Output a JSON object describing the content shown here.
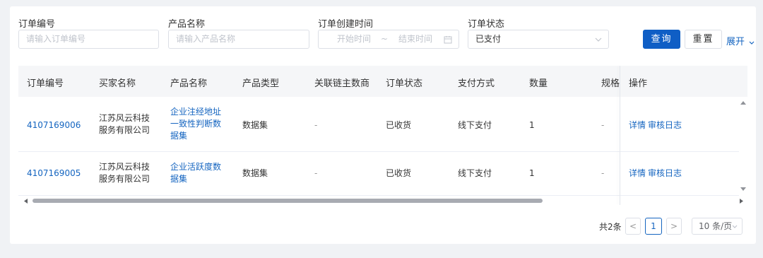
{
  "filters": {
    "order_no": {
      "label": "订单编号",
      "placeholder": "请输入订单编号"
    },
    "product_name": {
      "label": "产品名称",
      "placeholder": "请输入产品名称"
    },
    "create_time": {
      "label": "订单创建时间",
      "start_placeholder": "开始时间",
      "separator": "~",
      "end_placeholder": "结束时间"
    },
    "status": {
      "label": "订单状态",
      "value": "已支付"
    },
    "query_label": "查询",
    "reset_label": "重置",
    "expand_label": "展开"
  },
  "table": {
    "columns": [
      "订单编号",
      "买家名称",
      "产品名称",
      "产品类型",
      "关联链主数商",
      "订单状态",
      "支付方式",
      "数量",
      "规格",
      "操作"
    ],
    "rows": [
      {
        "order_no": "4107169006",
        "buyer": [
          "江苏风云科技",
          "服务有限公司"
        ],
        "product": [
          "企业注经地址",
          "一致性判断数",
          "据集"
        ],
        "type": "数据集",
        "chain": "-",
        "status": "已收货",
        "payment": "线下支付",
        "qty": "1",
        "spec": "-",
        "actions": [
          "详情",
          "审核日志"
        ]
      },
      {
        "order_no": "4107169005",
        "buyer": [
          "江苏风云科技",
          "服务有限公司"
        ],
        "product": [
          "企业活跃度数",
          "据集"
        ],
        "type": "数据集",
        "chain": "-",
        "status": "已收货",
        "payment": "线下支付",
        "qty": "1",
        "spec": "-",
        "actions": [
          "详情",
          "审核日志"
        ]
      }
    ]
  },
  "pagination": {
    "total_text": "共2条",
    "current_page": "1",
    "prev": "<",
    "next": ">",
    "page_size": "10 条/页"
  }
}
